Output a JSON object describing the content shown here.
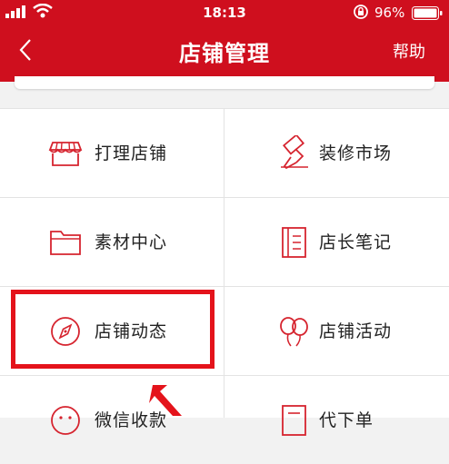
{
  "status_bar": {
    "time": "18:13",
    "battery": "96%"
  },
  "nav": {
    "title": "店铺管理",
    "help": "帮助"
  },
  "colors": {
    "brand_red": "#cf0f1e",
    "icon_red": "#d6242f",
    "highlight": "#e4131b"
  },
  "menu": {
    "items": [
      {
        "label": "打理店铺",
        "icon": "store-icon"
      },
      {
        "label": "装修市场",
        "icon": "paint-roller-icon"
      },
      {
        "label": "素材中心",
        "icon": "folder-icon"
      },
      {
        "label": "店长笔记",
        "icon": "notebook-icon"
      },
      {
        "label": "店铺动态",
        "icon": "compass-icon"
      },
      {
        "label": "店铺活动",
        "icon": "balloons-icon"
      },
      {
        "label": "微信收款",
        "icon": "wechat-pay-icon"
      },
      {
        "label": "代下单",
        "icon": "order-list-icon"
      }
    ]
  }
}
